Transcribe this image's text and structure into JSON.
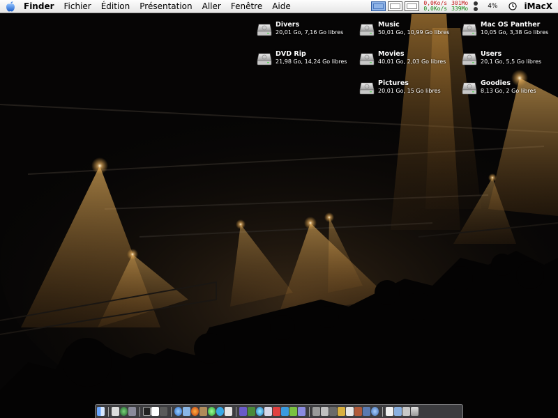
{
  "menubar": {
    "app_name": "Finder",
    "menus": [
      "Fichier",
      "Édition",
      "Présentation",
      "Aller",
      "Fenêtre",
      "Aide"
    ],
    "network": {
      "upload_rate": "0,0Ko/s",
      "download_rate": "0,0Ko/s",
      "upload_total": "301Mo",
      "download_total": "339Mo"
    },
    "cpu_usage": "4%",
    "machine_name": "iMacX"
  },
  "desktop": {
    "volumes": [
      {
        "name": "Divers",
        "info": "20,01 Go, 7,16 Go libres"
      },
      {
        "name": "DVD Rip",
        "info": "21,98 Go, 14,24 Go libres"
      },
      {
        "name": "Music",
        "info": "50,01 Go, 10,99 Go libres"
      },
      {
        "name": "Movies",
        "info": "40,01 Go, 2,03 Go libres"
      },
      {
        "name": "Pictures",
        "info": "20,01 Go, 15 Go libres"
      },
      {
        "name": "Mac OS Panther",
        "info": "10,05 Go, 3,38 Go libres"
      },
      {
        "name": "Users",
        "info": "20,1 Go, 5,5 Go libres"
      },
      {
        "name": "Goodies",
        "info": "8,13 Go, 2 Go libres"
      }
    ]
  },
  "colors": {
    "light_beam": "#d79a3c",
    "upload_color": "#c01818",
    "download_color": "#168a16"
  }
}
